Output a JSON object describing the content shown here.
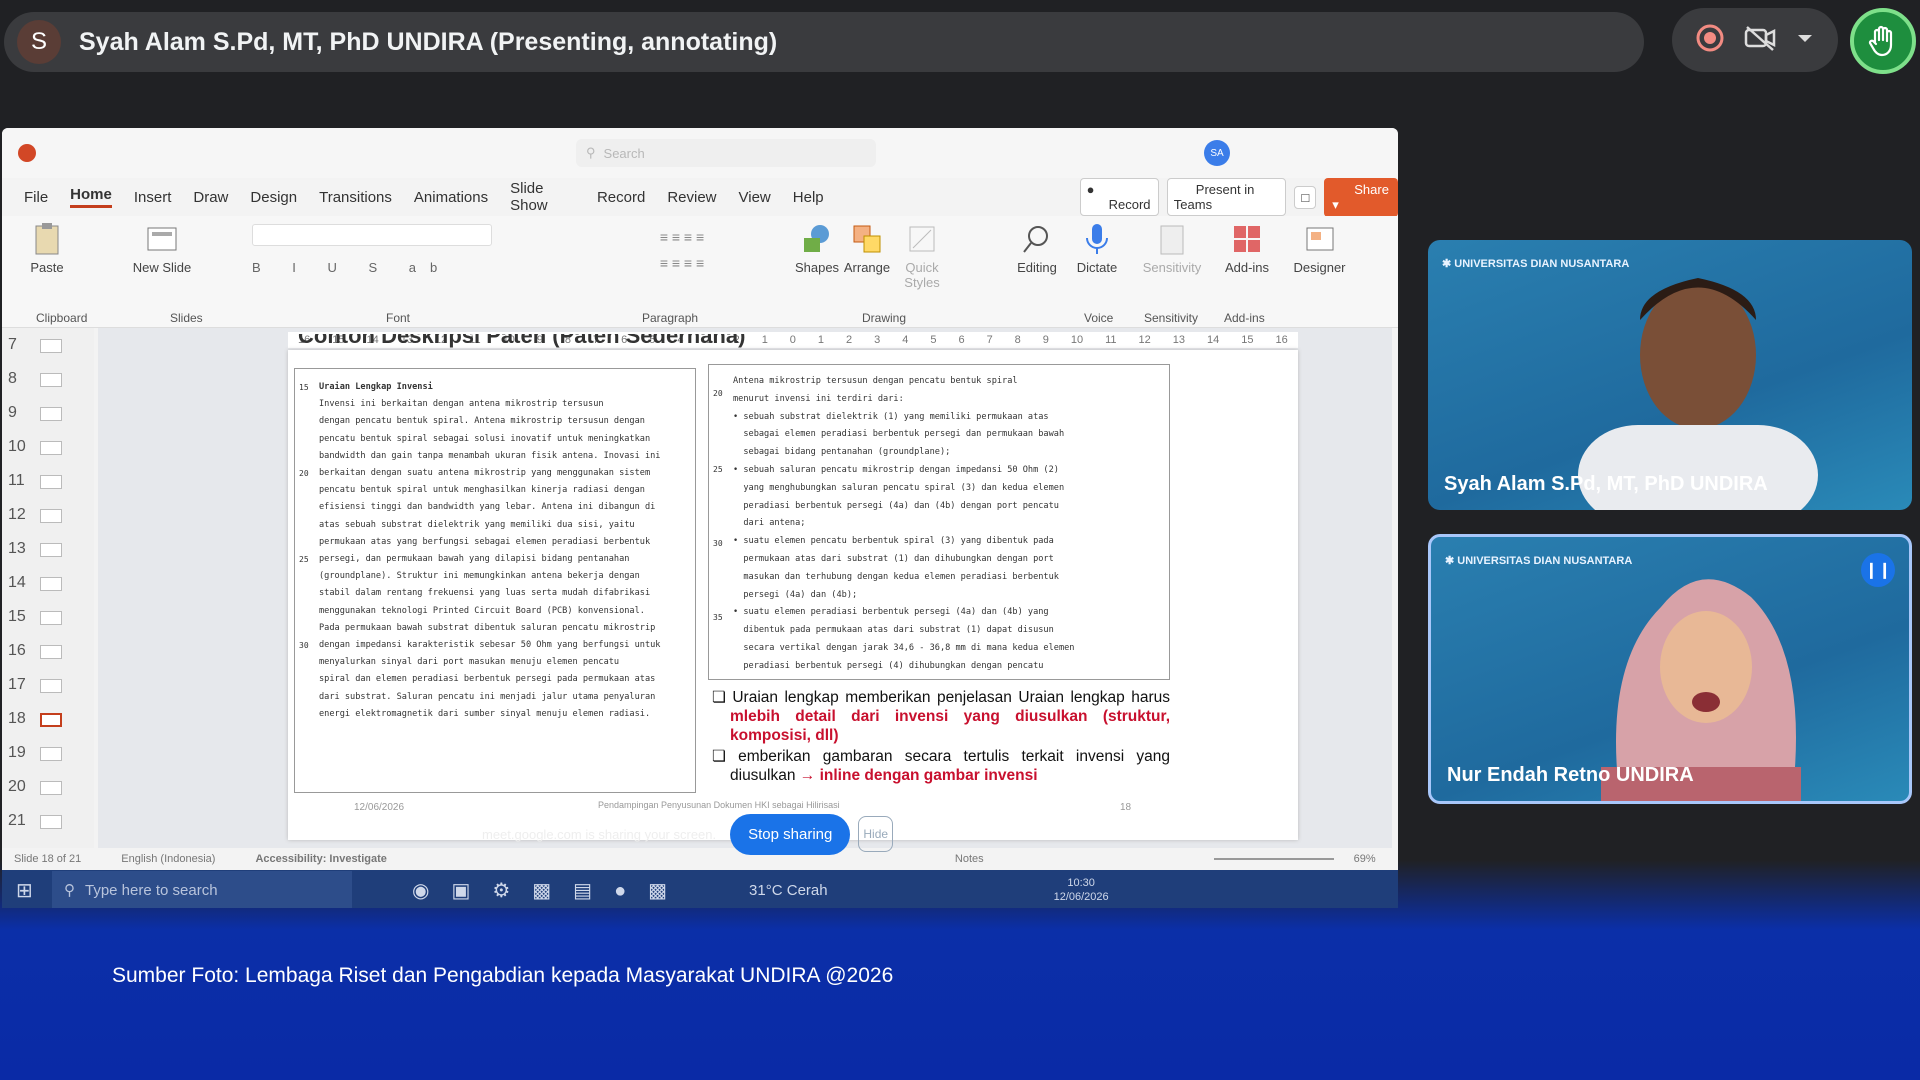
{
  "top_bar": {
    "avatar_letter": "S",
    "presenter_text": "Syah Alam S.Pd, MT, PhD UNDIRA (Presenting, annotating)"
  },
  "controls": {
    "record_icon": "record-icon",
    "camera_off_icon": "video-off-icon",
    "menu_icon": "chevron-down-icon",
    "hand_icon": "raise-hand-icon"
  },
  "ppt": {
    "menu": [
      "File",
      "Home",
      "Insert",
      "Draw",
      "Design",
      "Transitions",
      "Animations",
      "Slide Show",
      "Record",
      "Review",
      "View",
      "Help"
    ],
    "record_label": "Record",
    "present_label": "Present in Teams",
    "share_label": "Share",
    "search_placeholder": "Search",
    "ribbon": {
      "paste": "Paste",
      "new_slide": "New Slide",
      "shapes": "Shapes",
      "arrange": "Arrange",
      "quick_styles": "Quick Styles",
      "editing": "Editing",
      "dictate": "Dictate",
      "sensitivity": "Sensitivity",
      "addins": "Add-ins",
      "designer": "Designer",
      "groups": [
        "Clipboard",
        "Slides",
        "Font",
        "Paragraph",
        "Drawing",
        "Voice",
        "Sensitivity",
        "Add-ins"
      ]
    },
    "thumb_numbers": [
      "7",
      "8",
      "9",
      "10",
      "11",
      "12",
      "13",
      "14",
      "15",
      "16",
      "17",
      "18",
      "19",
      "20",
      "21"
    ],
    "ruler": [
      "16",
      "15",
      "14",
      "13",
      "12",
      "11",
      "10",
      "9",
      "8",
      "7",
      "6",
      "5",
      "4",
      "3",
      "2",
      "1",
      "0",
      "1",
      "2",
      "3",
      "4",
      "5",
      "6",
      "7",
      "8",
      "9",
      "10",
      "11",
      "12",
      "13",
      "14",
      "15",
      "16"
    ],
    "slide": {
      "title": "Contoh Deskripsi Paten (Paten Sederhana)",
      "left_heading": "Uraian Lengkap Invensi",
      "left_lines": [
        "Invensi ini berkaitan dengan antena mikrostrip tersusun",
        "dengan pencatu bentuk spiral. Antena mikrostrip tersusun dengan",
        "pencatu bentuk spiral sebagai solusi inovatif untuk meningkatkan",
        "bandwidth dan gain tanpa menambah ukuran fisik antena. Inovasi ini",
        "berkaitan dengan suatu antena mikrostrip yang menggunakan sistem",
        "pencatu bentuk spiral untuk menghasilkan kinerja radiasi dengan",
        "efisiensi tinggi dan bandwidth yang lebar. Antena ini dibangun di",
        "atas sebuah substrat dielektrik yang memiliki dua sisi, yaitu",
        "permukaan atas yang berfungsi sebagai elemen peradiasi berbentuk",
        "persegi, dan permukaan bawah yang dilapisi bidang pentanahan",
        "(groundplane). Struktur ini memungkinkan antena bekerja dengan",
        "stabil dalam rentang frekuensi yang luas serta mudah difabrikasi",
        "menggunakan teknologi Printed Circuit Board (PCB) konvensional.",
        "Pada permukaan bawah substrat dibentuk saluran pencatu mikrostrip",
        "dengan impedansi karakteristik sebesar 50 Ohm yang berfungsi untuk",
        "menyalurkan sinyal dari port masukan menuju elemen pencatu",
        "spiral dan elemen peradiasi berbentuk persegi pada permukaan atas",
        "dari substrat. Saluran pencatu ini menjadi jalur utama penyaluran",
        "energi elektromagnetik dari sumber sinyal menuju elemen radiasi."
      ],
      "left_line_numbers": [
        "15",
        "20",
        "25",
        "30"
      ],
      "right_lines": [
        "Antena mikrostrip tersusun dengan pencatu bentuk spiral",
        "menurut invensi ini terdiri dari:",
        "• sebuah substrat dielektrik (1) yang memiliki permukaan atas",
        "  sebagai elemen peradiasi berbentuk persegi dan permukaan bawah",
        "  sebagai bidang pentanahan (groundplane);",
        "• sebuah saluran pencatu mikrostrip dengan impedansi 50 Ohm (2)",
        "  yang menghubungkan saluran pencatu spiral (3) dan kedua elemen",
        "  peradiasi berbentuk persegi (4a) dan (4b) dengan port pencatu",
        "  dari antena;",
        "• suatu elemen pencatu berbentuk spiral (3) yang dibentuk pada",
        "  permukaan atas dari substrat (1) dan dihubungkan dengan port",
        "  masukan dan terhubung dengan kedua elemen peradiasi berbentuk",
        "  persegi (4a) dan (4b);",
        "• suatu elemen peradiasi berbentuk persegi (4a) dan (4b) yang",
        "  dibentuk pada permukaan atas dari substrat (1) dapat disusun",
        "  secara vertikal dengan jarak 34,6 - 36,8 mm di mana kedua elemen",
        "  peradiasi berbentuk persegi (4) dihubungkan dengan pencatu"
      ],
      "right_line_numbers": [
        "20",
        "25",
        "30",
        "35"
      ],
      "bullet1_plain": "Uraian lengkap memberikan penjelasan Uraian lengkap harus ",
      "bullet1_red": "mlebih detail dari invensi yang diusulkan (struktur, komposisi, dll)",
      "bullet2_plain": "emberikan gambaran secara tertulis terkait invensi yang diusulkan ",
      "bullet2_red": "→ inline dengan gambar invensi",
      "footer_date": "12/06/2026",
      "footer_center": "Pendampingan Penyusunan Dokumen HKI sebagai Hilirisasi",
      "footer_page": "18"
    },
    "status": {
      "slide": "Slide 18 of 21",
      "language": "English (Indonesia)",
      "accessibility": "Accessibility: Investigate",
      "notes": "Notes",
      "zoom": "69%"
    },
    "share_banner": {
      "text": "meet.google.com is sharing your screen.",
      "stop": "Stop sharing",
      "hide": "Hide"
    },
    "taskbar": {
      "search_placeholder": "Type here to search",
      "weather": "31°C Cerah",
      "time": "10:30",
      "date": "12/06/2026"
    }
  },
  "tiles": [
    {
      "name": "Syah Alam S.Pd, MT, PhD UNDIRA",
      "logo": "UNIVERSITAS DIAN NUSANTARA"
    },
    {
      "name": "Nur Endah Retno UNDIRA",
      "logo": "UNIVERSITAS DIAN NUSANTARA"
    }
  ],
  "caption": "Sumber Foto: Lembaga Riset dan Pengabdian kepada Masyarakat UNDIRA @2026",
  "colors": {
    "accent": "#1a73e8",
    "annotation": "#c8102e",
    "share_orange": "#e25a2b",
    "hand_green": "#1e8e3e"
  }
}
